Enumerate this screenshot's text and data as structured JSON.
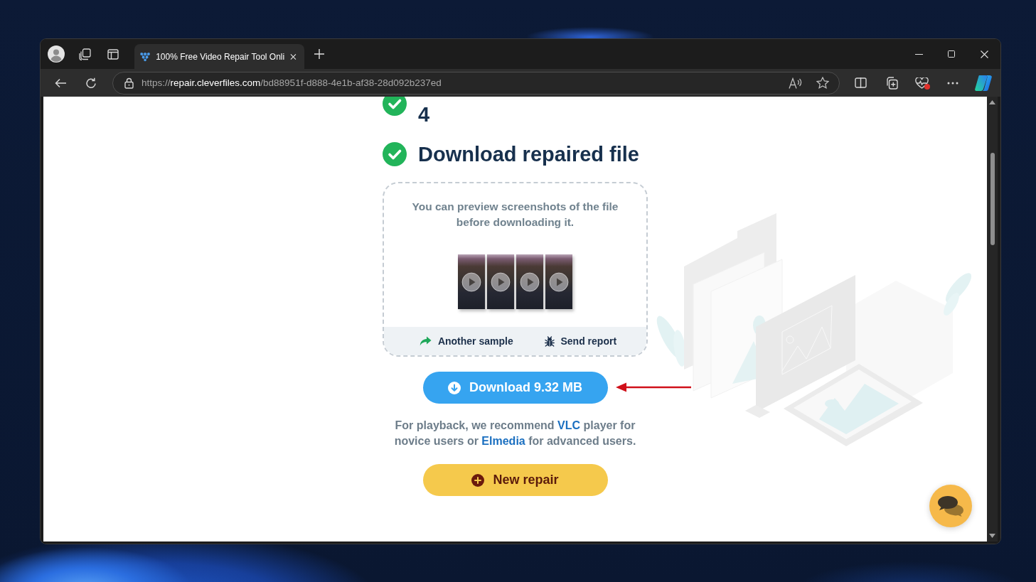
{
  "browser": {
    "tabs": [
      {
        "title": "100% Free Video Repair Tool Onli",
        "selected": true
      }
    ],
    "address": {
      "scheme": "https://",
      "host": "repair.cleverfiles.com",
      "path": "/bd88951f-d888-4e1b-af38-28d092b237ed"
    },
    "essentials_alert": true
  },
  "steps": [
    {
      "title": "4",
      "done": true
    },
    {
      "title": "Download repaired file",
      "done": true
    }
  ],
  "preview": {
    "text": "You can preview screenshots of the file before downloading it.",
    "thumbnails": [
      {
        "kind": "video-frame"
      },
      {
        "kind": "video-frame"
      },
      {
        "kind": "video-frame"
      },
      {
        "kind": "video-frame"
      }
    ],
    "actions": [
      {
        "label": "Another sample",
        "kind": "sample"
      },
      {
        "label": "Send report",
        "kind": "report"
      }
    ]
  },
  "download_button": {
    "label": "Download 9.32 MB"
  },
  "recommendation": [
    {
      "text": "For playback, we recommend ",
      "kind": "text"
    },
    {
      "text": "VLC",
      "kind": "link"
    },
    {
      "text": " player for novice users or ",
      "kind": "text"
    },
    {
      "text": "Elmedia",
      "kind": "link"
    },
    {
      "text": " for advanced users.",
      "kind": "text"
    }
  ],
  "new_repair_button": {
    "label": "New repair"
  }
}
